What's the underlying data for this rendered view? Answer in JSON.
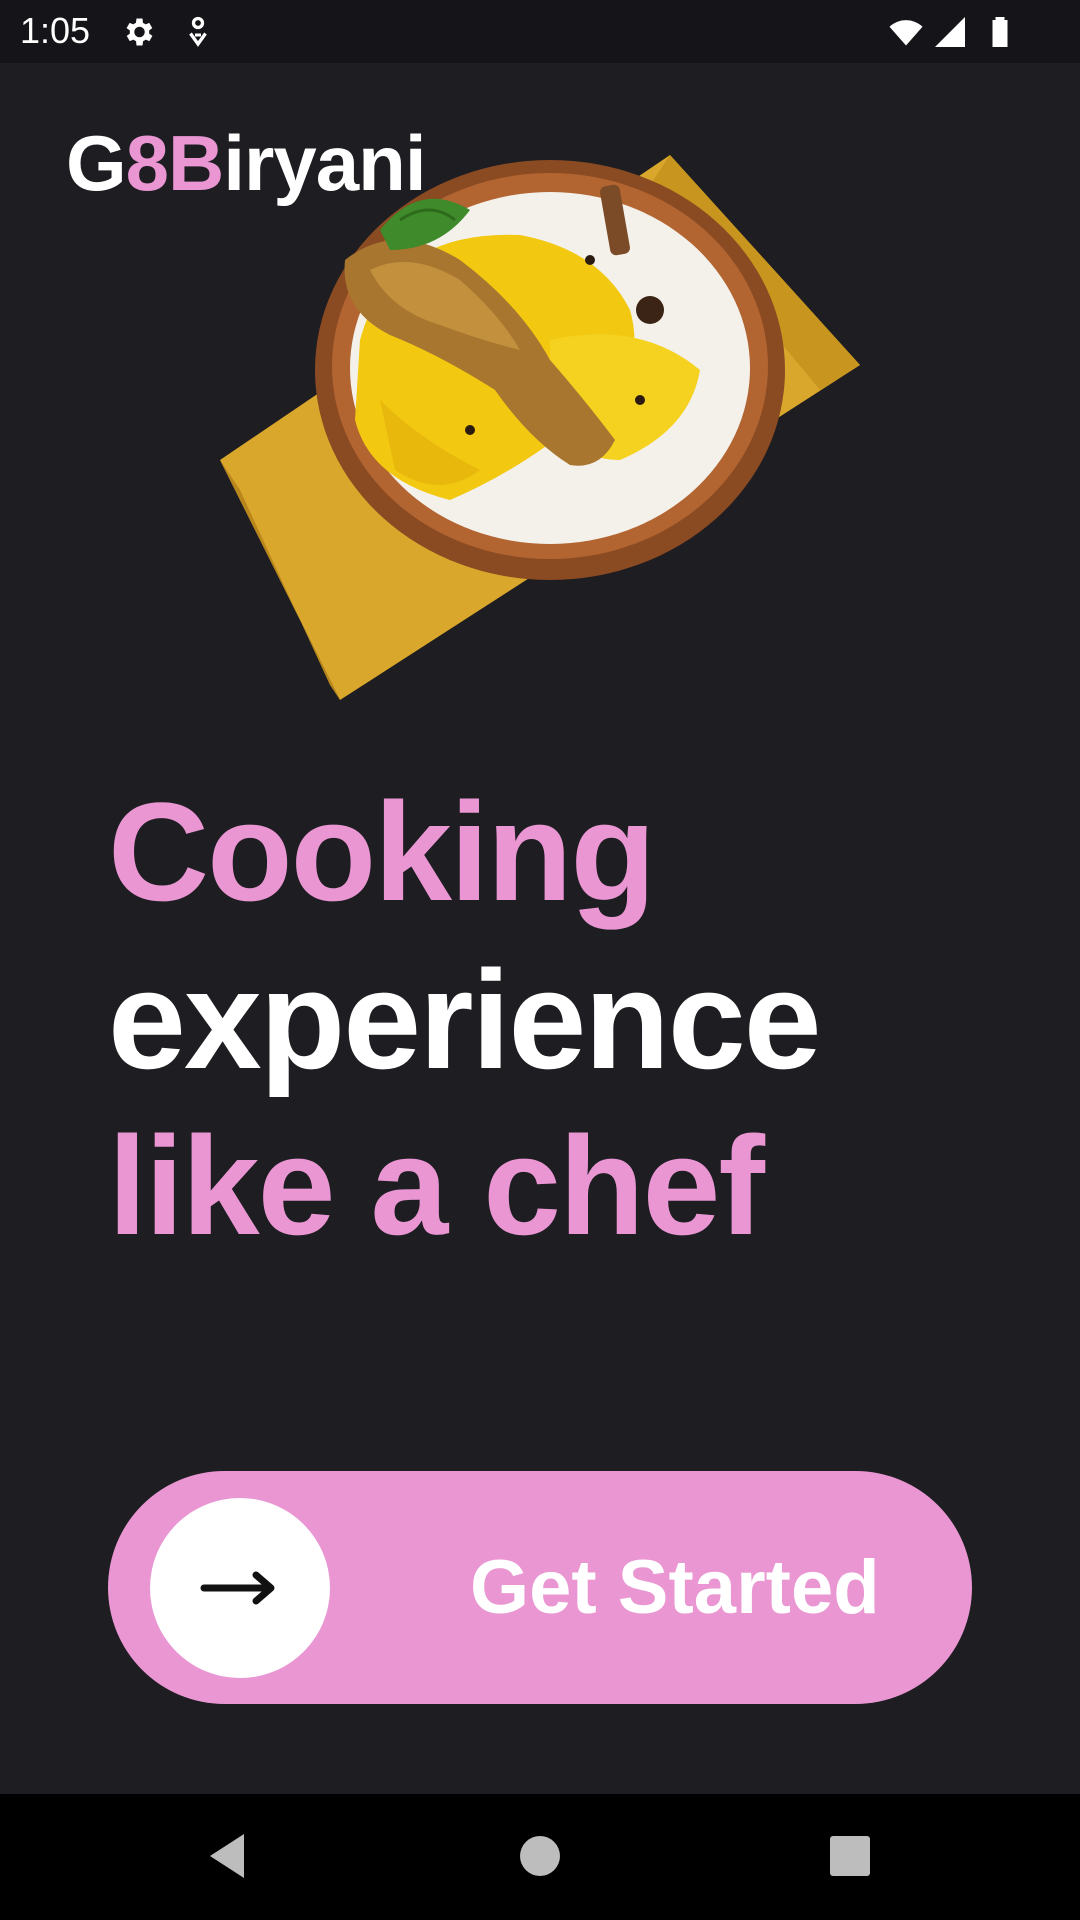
{
  "status_bar": {
    "time": "1:05",
    "icons": [
      "gear-icon",
      "location-icon",
      "wifi-icon",
      "signal-icon",
      "battery-icon"
    ]
  },
  "app": {
    "title_parts": [
      "G",
      "8B",
      "iryani"
    ],
    "headline": [
      "Cooking",
      "experience",
      "like a chef"
    ],
    "cta_label": "Get Started",
    "accent_color": "#e996d2",
    "background_color": "#1e1d22"
  },
  "nav_bar": {
    "buttons": [
      "back-icon",
      "home-icon",
      "recents-icon"
    ]
  }
}
